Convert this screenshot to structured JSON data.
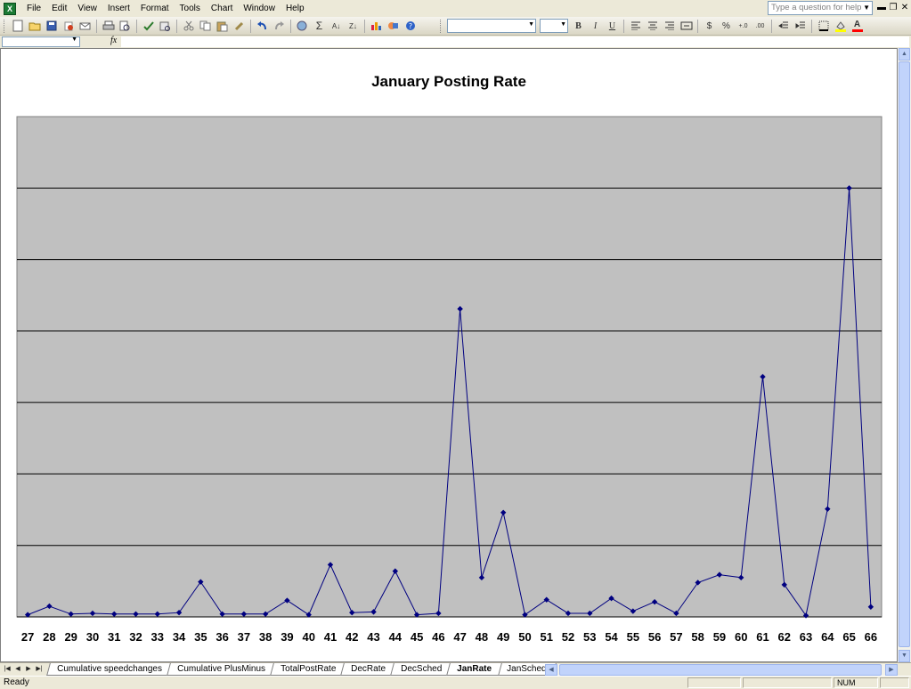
{
  "menubar": {
    "items": [
      "File",
      "Edit",
      "View",
      "Insert",
      "Format",
      "Tools",
      "Chart",
      "Window",
      "Help"
    ],
    "help_placeholder": "Type a question for help",
    "window_controls": [
      "minimize-icon",
      "restore-icon",
      "close-icon"
    ]
  },
  "toolbar": {
    "icons": [
      "new-icon",
      "open-icon",
      "save-icon",
      "permission-icon",
      "email-icon",
      "print-icon",
      "print-preview-icon",
      "spelling-icon",
      "research-icon",
      "cut-icon",
      "copy-icon",
      "paste-icon",
      "format-painter-icon",
      "undo-icon",
      "redo-icon",
      "hyperlink-icon",
      "autosum-icon",
      "sort-ascending-icon",
      "sort-descending-icon",
      "chart-wizard-icon",
      "drawing-icon",
      "help-icon"
    ],
    "format_icons": [
      "bold-icon",
      "italic-icon",
      "underline-icon",
      "align-left-icon",
      "center-icon",
      "align-right-icon",
      "merge-center-icon",
      "currency-icon",
      "percent-icon",
      "increase-decimal-icon",
      "decrease-decimal-icon",
      "decrease-indent-icon",
      "increase-indent-icon",
      "borders-icon",
      "fill-color-icon",
      "font-color-icon"
    ],
    "bold": "B",
    "italic": "I",
    "underline": "U",
    "currency": "$",
    "percent": "%",
    "font_color": "A"
  },
  "formula_bar": {
    "fx": "fx"
  },
  "chart_data": {
    "type": "line",
    "title": "January Posting Rate",
    "categories": [
      "27",
      "28",
      "29",
      "30",
      "31",
      "32",
      "33",
      "34",
      "35",
      "36",
      "37",
      "38",
      "39",
      "40",
      "41",
      "42",
      "43",
      "44",
      "45",
      "46",
      "47",
      "48",
      "49",
      "50",
      "51",
      "52",
      "53",
      "54",
      "55",
      "56",
      "57",
      "58",
      "59",
      "60",
      "61",
      "62",
      "63",
      "64",
      "65",
      "66"
    ],
    "values": [
      0.3,
      1.5,
      0.4,
      0.5,
      0.4,
      0.4,
      0.4,
      0.6,
      4.9,
      0.4,
      0.4,
      0.4,
      2.3,
      0.3,
      7.3,
      0.6,
      0.7,
      6.4,
      0.3,
      0.5,
      43.1,
      5.5,
      14.6,
      0.3,
      2.4,
      0.5,
      0.5,
      2.6,
      0.8,
      2.1,
      0.5,
      4.8,
      5.9,
      5.5,
      33.6,
      4.5,
      0.2,
      15.1,
      60.0,
      1.4
    ],
    "ylim": [
      0,
      70
    ],
    "y_gridline_step": 10,
    "grid": true,
    "series_color": "#000080",
    "plot_background": "#c0c0c0"
  },
  "sheet_tabs": {
    "tabs": [
      "Cumulative speedchanges",
      "Cumulative PlusMinus",
      "TotalPostRate",
      "DecRate",
      "DecSched",
      "JanRate",
      "JanSched"
    ],
    "active": "JanRate"
  },
  "statusbar": {
    "status": "Ready",
    "num_indicator": "NUM"
  }
}
